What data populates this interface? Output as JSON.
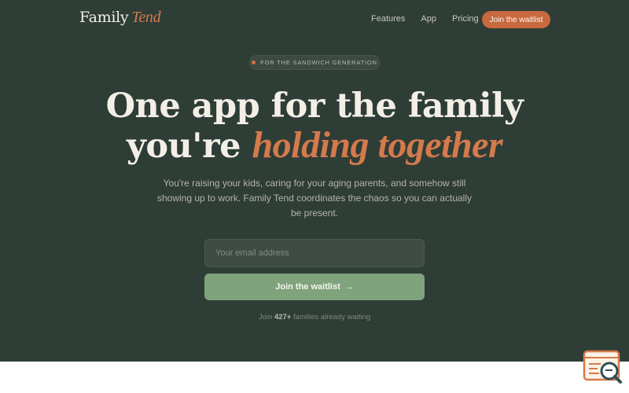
{
  "nav": {
    "logo_main": "Family",
    "logo_accent": "Tend",
    "links": [
      "Features",
      "App",
      "Pricing"
    ],
    "cta_label": "Join the waitlist"
  },
  "badge": {
    "label": "FOR THE SANDWICH GENERATION"
  },
  "hero": {
    "headline_line1": "One app for the family",
    "headline_line2_plain": "you're",
    "headline_line2_accent": "holding together",
    "subtitle": "You're raising your kids, caring for your aging parents, and somehow still showing up to work. Family Tend coordinates the chaos so you can actually be present."
  },
  "form": {
    "email_placeholder": "Your email address",
    "email_value": "",
    "submit_label": "Join the waitlist",
    "submit_arrow": "→"
  },
  "social_proof": {
    "prefix": "Join",
    "count": "427+",
    "suffix": "families already waiting"
  },
  "colors": {
    "background": "#2f3d37",
    "accent": "#d47a4c",
    "cta": "#c8693f",
    "submit": "#7fa37d"
  },
  "icons": {
    "widget": "search-feedback-icon"
  }
}
